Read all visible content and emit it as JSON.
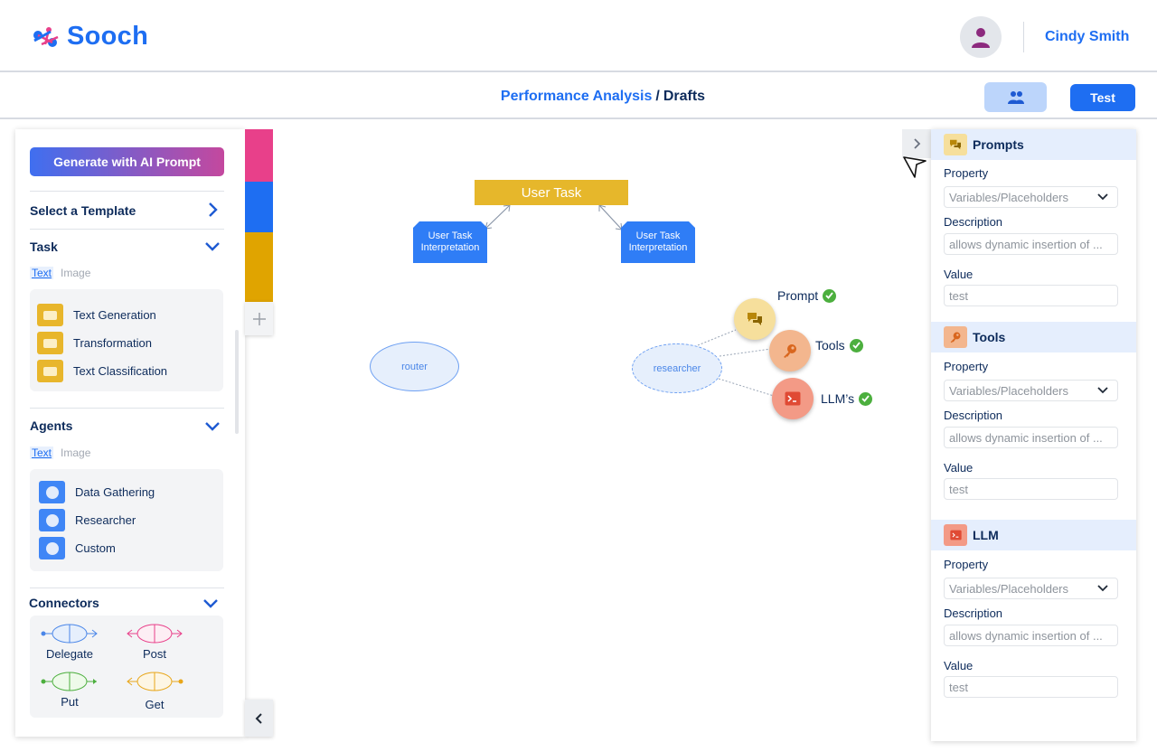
{
  "app": {
    "logo": "Sooch"
  },
  "header": {
    "user_name": "Cindy Smith"
  },
  "subheader": {
    "crumb_project": "Performance Analysis",
    "crumb_sep": "/",
    "crumb_page": "Drafts",
    "test_label": "Test"
  },
  "left": {
    "generate_label": "Generate with AI Prompt",
    "template_label": "Select a  Template",
    "task": {
      "title": "Task",
      "tab_text": "Text",
      "tab_image": "Image",
      "items": [
        "Text Generation",
        "Transformation",
        "Text Classification"
      ]
    },
    "agents": {
      "title": "Agents",
      "tab_text": "Text",
      "tab_image": "Image",
      "items": [
        "Data Gathering",
        "Researcher",
        "Custom"
      ]
    },
    "connectors": {
      "title": "Connectors",
      "items": [
        "Delegate",
        "Post",
        "Put",
        "Get"
      ]
    }
  },
  "colors": {
    "brand": "#1e6ef2",
    "strip": [
      "#e8408a",
      "#1e6ef2",
      "#e0a400"
    ]
  },
  "canvas": {
    "user_task": "User Task",
    "interpretation_left": "User Task Interpretation",
    "interpretation_right": "User Task Interpretation",
    "router": "router",
    "researcher": "researcher",
    "prompt_label": "Prompt",
    "tools_label": "Tools",
    "llm_label": "LLM’s"
  },
  "right": {
    "sections": [
      {
        "title": "Prompts",
        "property_label": "Property",
        "property_value": "Variables/Placeholders",
        "description_label": "Description",
        "description_value": "allows dynamic insertion of ...",
        "value_label": "Value",
        "value_value": "test"
      },
      {
        "title": "Tools",
        "property_label": "Property",
        "property_value": "Variables/Placeholders",
        "description_label": "Description",
        "description_value": "allows dynamic insertion of ...",
        "value_label": "Value",
        "value_value": "test"
      },
      {
        "title": "LLM",
        "property_label": "Property",
        "property_value": "Variables/Placeholders",
        "description_label": "Description",
        "description_value": "allows dynamic insertion of ...",
        "value_label": "Value",
        "value_value": "test"
      }
    ]
  }
}
